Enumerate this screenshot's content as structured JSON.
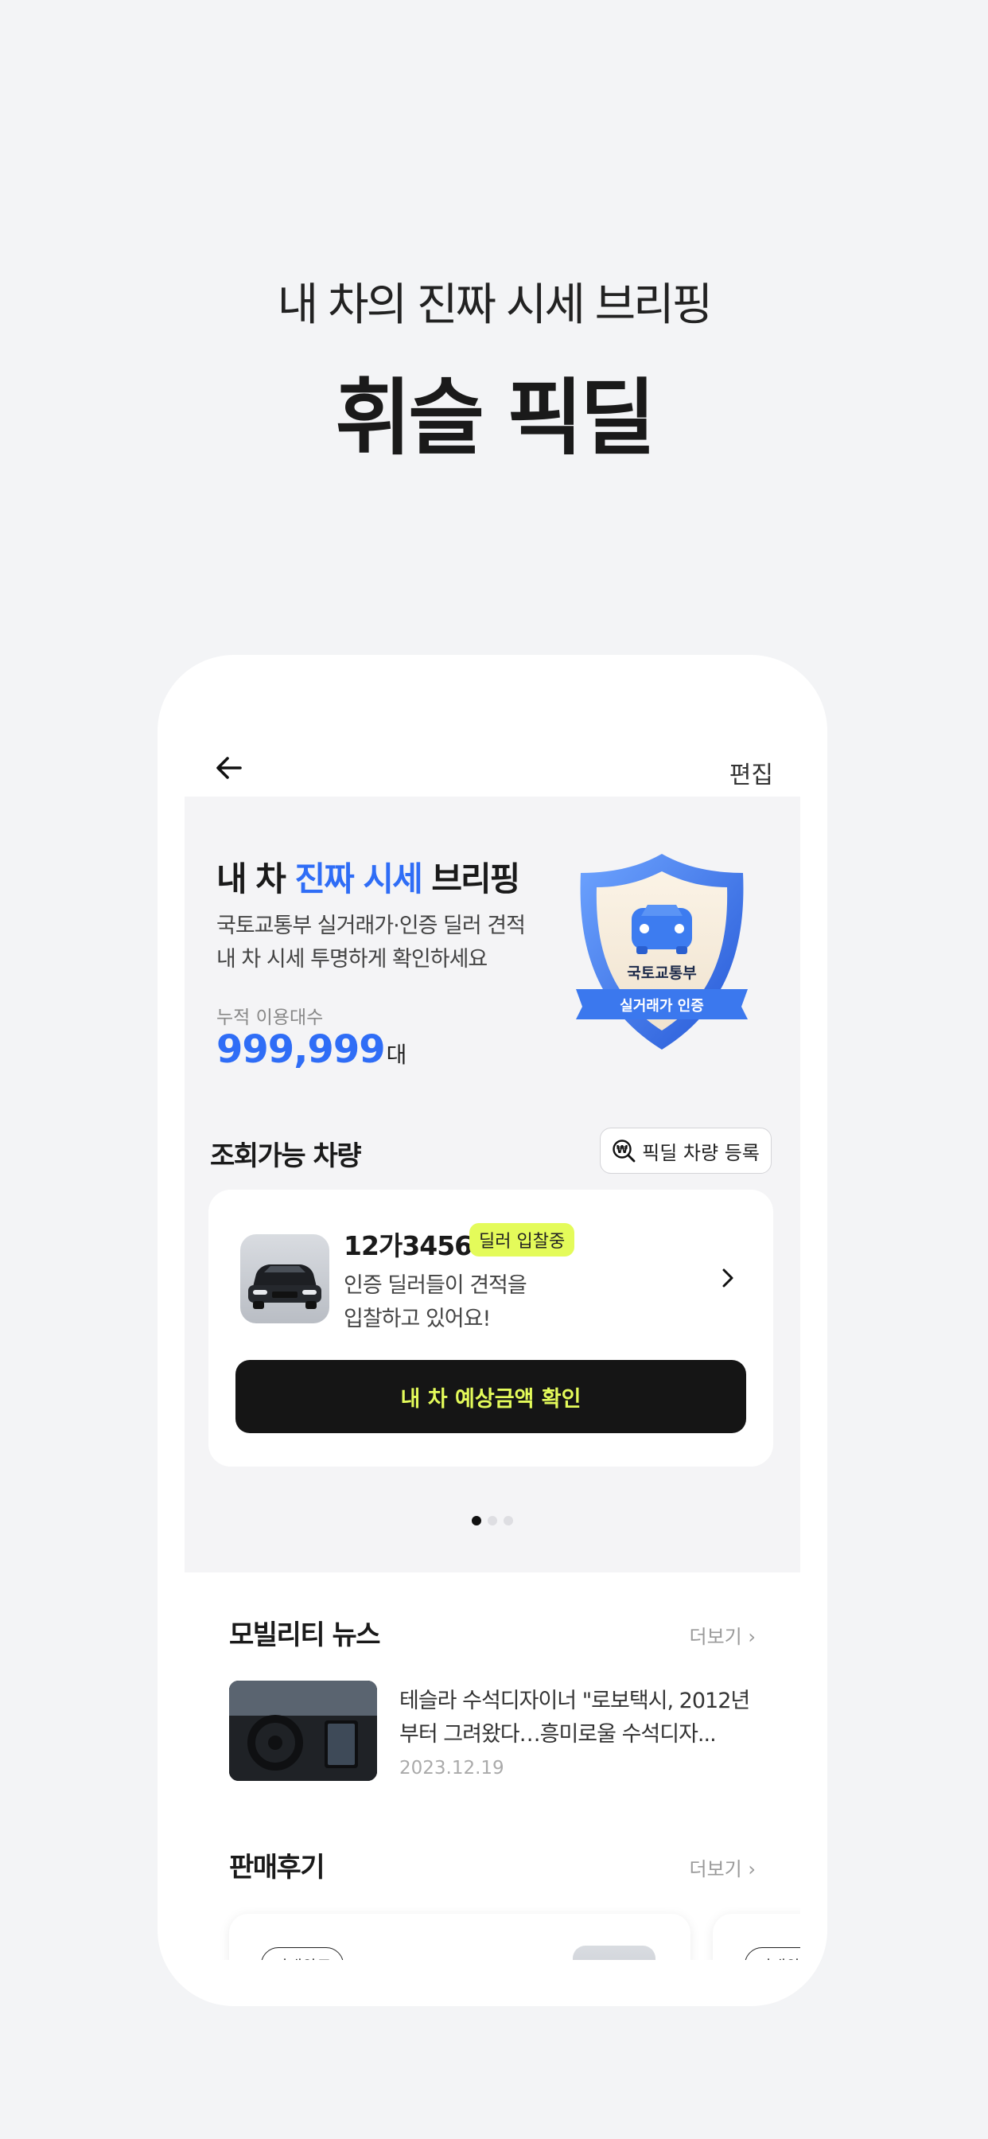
{
  "promo": {
    "subtitle": "내 차의 진짜 시세 브리핑",
    "title": "휘슬 픽딜"
  },
  "nav": {
    "back_icon": "arrow-left-icon",
    "edit_label": "편집"
  },
  "hero": {
    "title_prefix": "내 차 ",
    "title_highlight": "진짜 시세",
    "title_suffix": " 브리핑",
    "desc_line1": "국토교통부 실거래가·인증 딜러 견적",
    "desc_line2": "내 차 시세 투명하게 확인하세요",
    "stat_label": "누적 이용대수",
    "stat_value": "999,999",
    "stat_unit": "대",
    "shield_line1": "국토교통부",
    "shield_line2": "실거래가 인증",
    "highlight_color": "#2f6df6"
  },
  "vehicles": {
    "section_title": "조회가능 차량",
    "register_label": "픽딜 차량 등록",
    "register_icon": "won-search-icon",
    "card": {
      "plate": "12가3456",
      "badge": "딜러 입찰중",
      "desc_line1": "인증 딜러들이 견적을",
      "desc_line2": "입찰하고 있어요!",
      "cta_label": "내 차 예상금액 확인"
    },
    "pagination": {
      "total": 3,
      "active": 1
    },
    "accent_color": "#e4fb5a"
  },
  "news": {
    "section_title": "모빌리티 뉴스",
    "more_label": "더보기",
    "item": {
      "headline_line1": "테슬라 수석디자이너 \"로보택시, 2012년",
      "headline_line2": "부터 그려왔다…흥미로울 수석디자...",
      "date": "2023.12.19"
    }
  },
  "reviews": {
    "section_title": "판매후기",
    "more_label": "더보기",
    "cards": [
      {
        "badge": "거래완료"
      },
      {
        "badge": "거래완료"
      }
    ]
  }
}
